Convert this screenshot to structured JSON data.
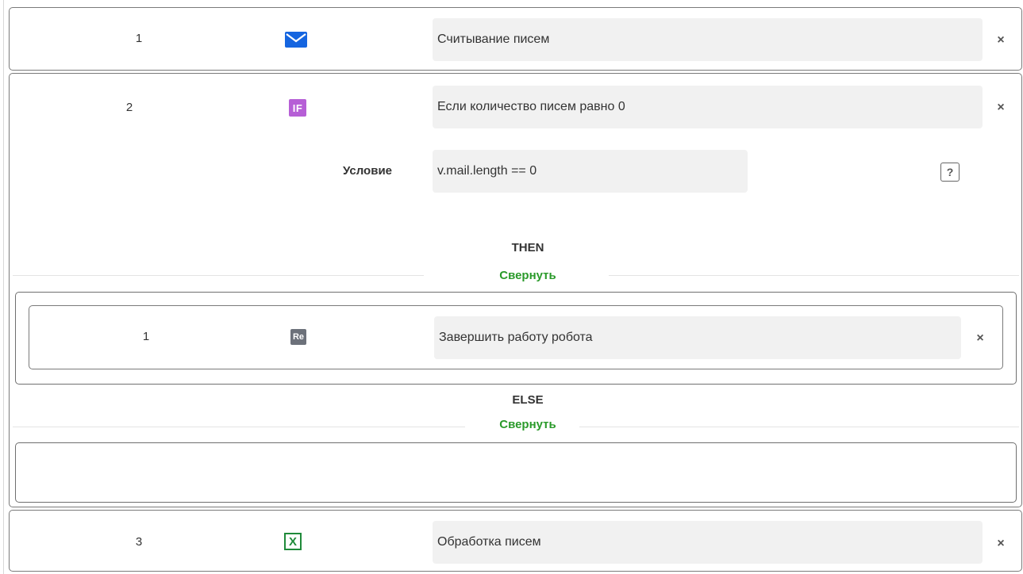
{
  "steps": [
    {
      "number": "1",
      "icon": "mail-icon",
      "text": "Считывание писем",
      "close": "×"
    },
    {
      "number": "2",
      "icon": "if-icon",
      "icon_text": "IF",
      "text": "Если количество писем равно 0",
      "close": "×",
      "condition_label": "Условие",
      "condition_value": "v.mail.length == 0",
      "help": "?",
      "then": {
        "title": "THEN",
        "collapse": "Свернуть",
        "steps": [
          {
            "number": "1",
            "icon": "re-icon",
            "icon_text": "Re",
            "text": "Завершить работу робота",
            "close": "×"
          }
        ]
      },
      "else": {
        "title": "ELSE",
        "collapse": "Свернуть",
        "steps": []
      }
    },
    {
      "number": "3",
      "icon": "excel-icon",
      "icon_text": "X",
      "text": "Обработка писем",
      "close": "×"
    }
  ],
  "colors": {
    "if": "#b65fd6",
    "re": "#6c717a",
    "excel": "#1f8a3a",
    "mail": "#1565e0",
    "link": "#2a9a2a"
  }
}
